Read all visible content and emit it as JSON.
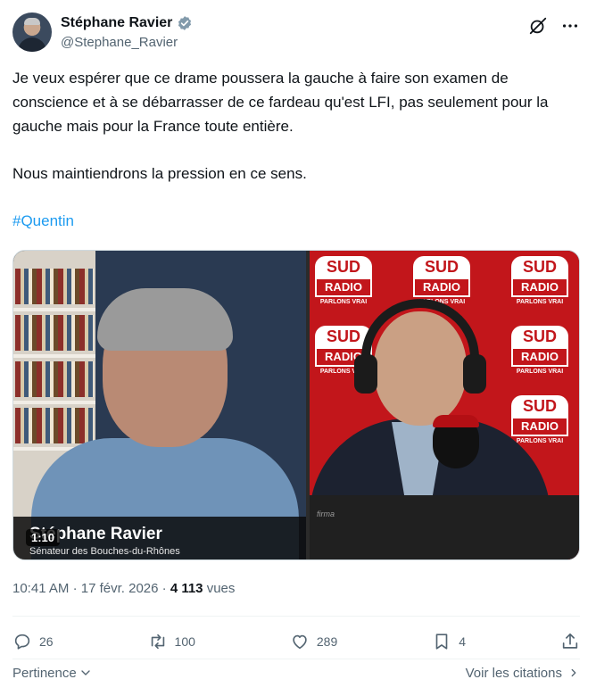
{
  "author": {
    "display_name": "Stéphane Ravier",
    "handle": "@Stephane_Ravier",
    "verified": true,
    "verified_color": "#829aab"
  },
  "post": {
    "paragraphs": [
      "Je veux espérer que ce drame poussera la gauche à faire son examen de conscience et à se débarrasser de ce fardeau qu'est LFI, pas seulement pour la gauche mais pour la France toute entière.",
      "Nous maintiendrons la pression en ce sens."
    ],
    "hashtag": "#Quentin",
    "hashtag_color": "#1d9bf0"
  },
  "video": {
    "duration": "1:10",
    "lower_third_name": "Stéphane Ravier",
    "lower_third_title": "Sénateur des Bouches-du-Rhônes",
    "logo_top": "SUD",
    "logo_bottom": "RADIO",
    "logo_tagline": "PARLONS VRAI",
    "desk_brand": "firma",
    "brand_color": "#c2161b"
  },
  "meta": {
    "time": "10:41 AM",
    "separator": "·",
    "date": "17 févr. 2026",
    "views_count": "4 113",
    "views_label": "vues"
  },
  "actions": {
    "replies": "26",
    "reposts": "100",
    "likes": "289",
    "bookmarks": "4"
  },
  "icons": {
    "grok": "grok-icon",
    "more": "more-icon",
    "reply": "reply-icon",
    "repost": "repost-icon",
    "like": "heart-icon",
    "bookmark": "bookmark-icon",
    "share": "share-icon",
    "chevron_down": "chevron-down-icon",
    "chevron_right": "chevron-right-icon"
  },
  "footer": {
    "sort_label": "Pertinence",
    "quotes_label": "Voir les citations"
  }
}
